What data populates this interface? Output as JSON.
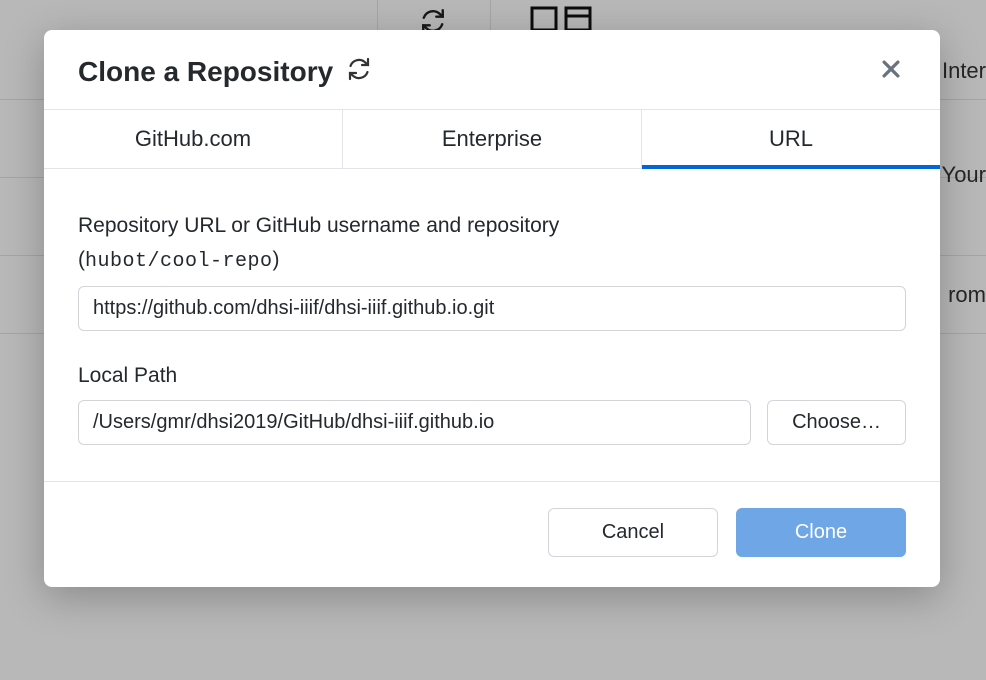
{
  "background": {
    "rightText1": "Inter",
    "rightText2": "Your",
    "rightText3": "rom "
  },
  "modal": {
    "title": "Clone a Repository",
    "tabs": {
      "github": "GitHub.com",
      "enterprise": "Enterprise",
      "url": "URL"
    },
    "fields": {
      "url_label_line1": "Repository URL or GitHub username and repository",
      "url_hint_open": "(",
      "url_hint_code": "hubot/cool-repo",
      "url_hint_close": ")",
      "url_value": "https://github.com/dhsi-iiif/dhsi-iiif.github.io.git",
      "path_label": "Local Path",
      "path_value": "/Users/gmr/dhsi2019/GitHub/dhsi-iiif.github.io",
      "choose_label": "Choose…"
    },
    "buttons": {
      "cancel": "Cancel",
      "clone": "Clone"
    }
  }
}
